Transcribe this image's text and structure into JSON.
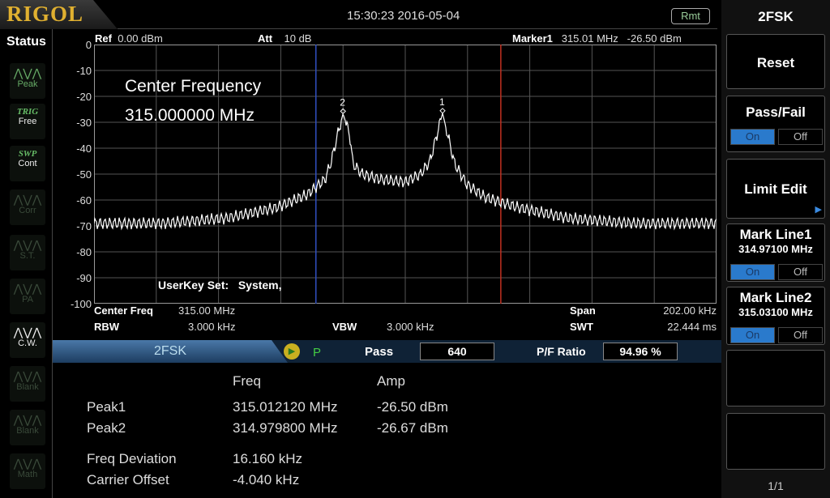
{
  "header": {
    "logo": "RIGOL",
    "datetime": "15:30:23 2016-05-04",
    "remote_badge": "Rmt"
  },
  "status": {
    "title": "Status",
    "buttons": [
      {
        "icon": "peak-icon",
        "label": "Peak",
        "state": "active"
      },
      {
        "tag": "TRIG",
        "label": "Free",
        "state": "active"
      },
      {
        "tag": "SWP",
        "label": "Cont",
        "state": "active"
      },
      {
        "icon": "corr-icon",
        "label": "Corr",
        "state": "dim"
      },
      {
        "icon": "st-icon",
        "label": "S.T.",
        "state": "dim"
      },
      {
        "icon": "pa-icon",
        "label": "PA",
        "state": "dim"
      },
      {
        "icon": "cw-icon",
        "label": "C.W.",
        "state": "on"
      },
      {
        "icon": "blank-icon",
        "label": "Blank",
        "state": "dim"
      },
      {
        "icon": "blank-icon",
        "label": "Blank",
        "state": "dim"
      },
      {
        "icon": "math-icon",
        "label": "Math",
        "state": "dim"
      }
    ]
  },
  "plot_header": {
    "ref_label": "Ref",
    "ref_value": "0.00 dBm",
    "att_label": "Att",
    "att_value": "10 dB",
    "marker_label": "Marker1",
    "marker_freq": "315.01 MHz",
    "marker_amp": "-26.50 dBm"
  },
  "annotation": {
    "line1": "Center Frequency",
    "line2": "315.000000 MHz",
    "userkey": "UserKey Set:   System,"
  },
  "plot_footer": {
    "center_label": "Center Freq",
    "center_value": "315.00 MHz",
    "span_label": "Span",
    "span_value": "202.00 kHz",
    "rbw_label": "RBW",
    "rbw_value": "3.000 kHz",
    "vbw_label": "VBW",
    "vbw_value": "3.000 kHz",
    "swt_label": "SWT",
    "swt_value": "22.444 ms"
  },
  "fsk_bar": {
    "mode": "2FSK",
    "run_letter": "P",
    "pass_label": "Pass",
    "pass_value": "640",
    "ratio_label": "P/F Ratio",
    "ratio_value": "94.96 %"
  },
  "measurements": {
    "col_freq": "Freq",
    "col_amp": "Amp",
    "rows": [
      {
        "name": "Peak1",
        "freq": "315.012120 MHz",
        "amp": "-26.50 dBm"
      },
      {
        "name": "Peak2",
        "freq": "314.979800 MHz",
        "amp": "-26.67 dBm"
      }
    ],
    "deviation_label": "Freq Deviation",
    "deviation_value": "16.160 kHz",
    "offset_label": "Carrier Offset",
    "offset_value": "-4.040 kHz"
  },
  "softkeys": {
    "title": "2FSK",
    "reset": "Reset",
    "passfail": "Pass/Fail",
    "on": "On",
    "off": "Off",
    "limit_edit": "Limit Edit",
    "markline1": "Mark Line1",
    "markline1_value": "314.97100 MHz",
    "markline2": "Mark Line2",
    "markline2_value": "315.03100 MHz",
    "page": "1/1"
  },
  "chart_data": {
    "type": "line",
    "xlabel": "",
    "ylabel": "",
    "xlim": [
      314.899,
      315.101
    ],
    "ylim": [
      -100,
      0
    ],
    "yticks": [
      "0",
      "-10",
      "-20",
      "-30",
      "-40",
      "-50",
      "-60",
      "-70",
      "-80",
      "-90",
      "-100"
    ],
    "grid": true,
    "trace_color": "#ffffff",
    "x": [
      314.899,
      314.921,
      314.942,
      314.958,
      314.968,
      314.974,
      314.976,
      314.978,
      314.9798,
      314.982,
      314.983,
      314.986,
      314.992,
      315.0,
      315.005,
      315.008,
      315.01,
      315.0121,
      315.014,
      315.016,
      315.02,
      315.026,
      315.037,
      315.053,
      315.074,
      315.101
    ],
    "y": [
      -69,
      -69,
      -67,
      -63,
      -58,
      -52,
      -45,
      -35,
      -26.67,
      -35,
      -46,
      -50,
      -52,
      -53,
      -50,
      -45,
      -36,
      -26.5,
      -36,
      -46,
      -54,
      -59,
      -63,
      -67,
      -69,
      -69
    ],
    "markers": [
      {
        "label": "1",
        "x": 315.0121,
        "y": -26.5
      },
      {
        "label": "2",
        "x": 314.9798,
        "y": -26.67
      }
    ],
    "mark_lines": [
      {
        "x": 314.971,
        "color": "#3050c0"
      },
      {
        "x": 315.031,
        "color": "#c03020"
      }
    ]
  }
}
